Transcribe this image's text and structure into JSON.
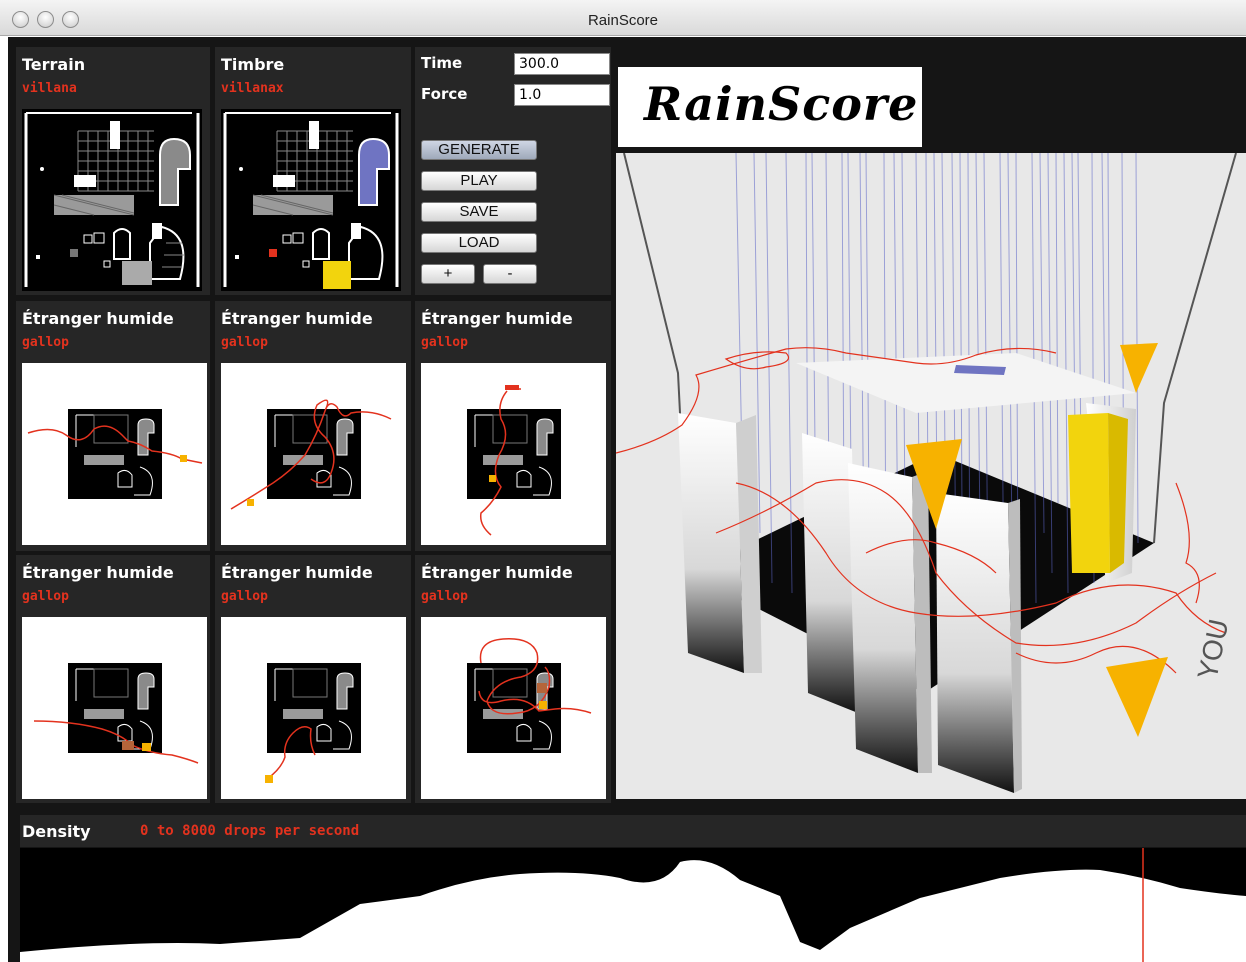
{
  "window": {
    "title": "RainScore"
  },
  "controls": {
    "time_label": "Time",
    "time_value": "300.0",
    "force_label": "Force",
    "force_value": "1.0",
    "generate_label": "GENERATE",
    "play_label": "PLAY",
    "save_label": "SAVE",
    "load_label": "LOAD",
    "plus_label": "+",
    "minus_label": "-"
  },
  "terrain": {
    "title": "Terrain",
    "name": "villana"
  },
  "timbre": {
    "title": "Timbre",
    "name": "villanax"
  },
  "walkers": [
    {
      "title": "Étranger humide",
      "style": "gallop"
    },
    {
      "title": "Étranger humide",
      "style": "gallop"
    },
    {
      "title": "Étranger humide",
      "style": "gallop"
    },
    {
      "title": "Étranger humide",
      "style": "gallop"
    },
    {
      "title": "Étranger humide",
      "style": "gallop"
    },
    {
      "title": "Étranger humide",
      "style": "gallop"
    }
  ],
  "logo": {
    "text": "RainScore"
  },
  "viewport": {
    "listener_label": "YOU"
  },
  "density": {
    "label": "Density",
    "range": "0 to 8000 drops per second"
  },
  "colors": {
    "accent_red": "#e3321e",
    "yellow": "#f2d40d",
    "orange": "#f7b200",
    "blue": "#6f74c2"
  }
}
